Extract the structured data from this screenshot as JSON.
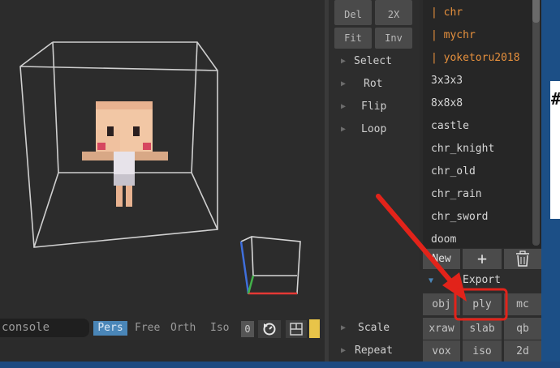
{
  "viewport": {
    "console_placeholder": "console",
    "view_modes": [
      "Pers",
      "Free",
      "Orth",
      "Iso"
    ],
    "counter_value": "0"
  },
  "tools": {
    "buttons_row_a": [
      "Del",
      "2X"
    ],
    "buttons_row_b": [
      "Fit",
      "Inv"
    ],
    "menu_items": [
      "Select",
      "Rot",
      "Flip",
      "Loop"
    ],
    "bottom_items": [
      "Scale",
      "Repeat"
    ]
  },
  "file_list": {
    "items": [
      {
        "label": "| chr",
        "color": "#e6903d"
      },
      {
        "label": "| mychr",
        "color": "#e6903d"
      },
      {
        "label": "| yoketoru2018",
        "color": "#e6903d"
      },
      {
        "label": "3x3x3",
        "color": "#d8d8d8"
      },
      {
        "label": "8x8x8",
        "color": "#d8d8d8"
      },
      {
        "label": "castle",
        "color": "#d8d8d8"
      },
      {
        "label": "chr_knight",
        "color": "#d8d8d8"
      },
      {
        "label": "chr_old",
        "color": "#d8d8d8"
      },
      {
        "label": "chr_rain",
        "color": "#d8d8d8"
      },
      {
        "label": "chr_sword",
        "color": "#d8d8d8"
      },
      {
        "label": "doom",
        "color": "#d8d8d8"
      }
    ],
    "new_label": "New",
    "add_icon": "+"
  },
  "export": {
    "title": "Export",
    "rows": [
      [
        "obj",
        "ply",
        "mc"
      ],
      [
        "xraw",
        "slab",
        "qb"
      ],
      [
        "vox",
        "iso",
        "2d"
      ]
    ],
    "highlighted": "ply"
  },
  "colors": {
    "accent_blue": "#4a86b8",
    "highlight_red": "#e2231a",
    "orange_text": "#e6903d",
    "swatch_yellow": "#e8c449"
  }
}
